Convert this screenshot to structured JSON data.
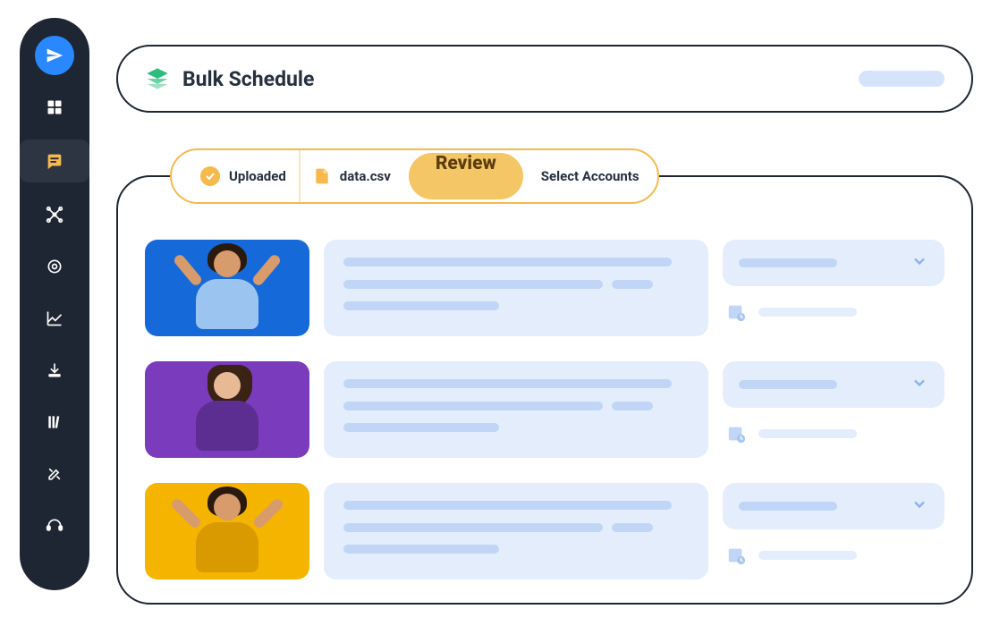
{
  "header": {
    "title": "Bulk Schedule"
  },
  "steps": {
    "uploaded": "Uploaded",
    "filename": "data.csv",
    "review": "Review",
    "select_accounts": "Select Accounts"
  },
  "rows": [
    {
      "thumb_color": "blue"
    },
    {
      "thumb_color": "purple"
    },
    {
      "thumb_color": "yellow"
    }
  ],
  "sidebar": {
    "items": [
      {
        "name": "send",
        "active": false
      },
      {
        "name": "grid",
        "active": false
      },
      {
        "name": "posts",
        "active": true
      },
      {
        "name": "network",
        "active": false
      },
      {
        "name": "target",
        "active": false
      },
      {
        "name": "analytics",
        "active": false
      },
      {
        "name": "download",
        "active": false
      },
      {
        "name": "library",
        "active": false
      },
      {
        "name": "tools",
        "active": false
      },
      {
        "name": "support",
        "active": false
      }
    ]
  }
}
